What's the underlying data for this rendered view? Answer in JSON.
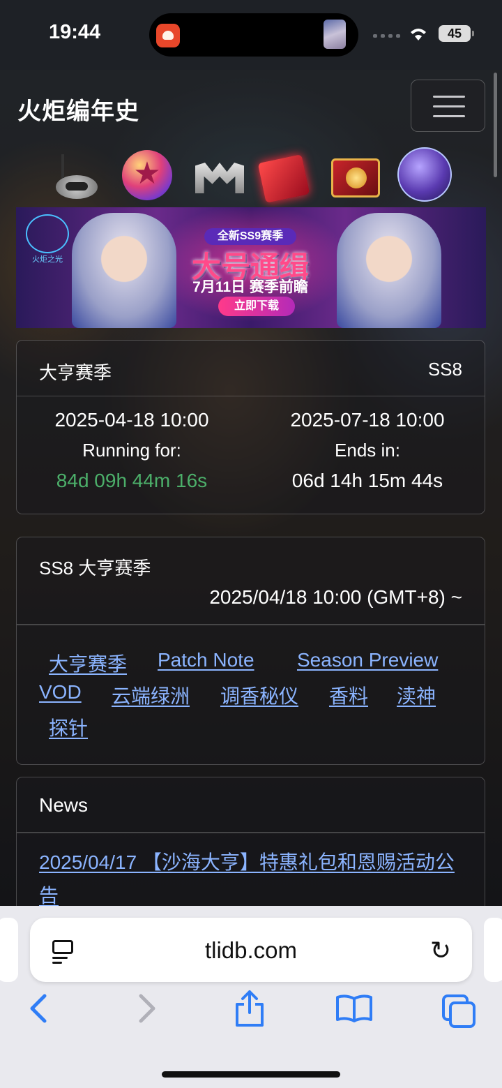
{
  "status_bar": {
    "time": "19:44",
    "battery": "45"
  },
  "header": {
    "site_title": "火炬编年史",
    "menu_icon": "hamburger-menu-icon"
  },
  "icon_row": [
    "mask-relic-icon",
    "star-orb-icon",
    "legendary-gear-icon",
    "red-cube-icon",
    "treasure-chest-icon",
    "void-crystal-icon"
  ],
  "banner": {
    "logo_text": "火炬之光",
    "tag": "全新SS9赛季",
    "headline": "大号通缉",
    "date": "7月11日 赛季前瞻",
    "cta": "立即下载"
  },
  "season_card": {
    "name": "大亨赛季",
    "code": "SS8",
    "start_datetime": "2025-04-18 10:00",
    "end_datetime": "2025-07-18 10:00",
    "running_label": "Running for:",
    "ends_label": "Ends in:",
    "running_value": "84d 09h 44m 16s",
    "ends_value": "06d 14h 15m 44s",
    "colors": {
      "running": "#4caf6a"
    }
  },
  "season_info": {
    "title": "SS8 大亨赛季",
    "start": "2025/04/18 10:00 (GMT+8) ~",
    "links": [
      "大亨赛季",
      "Patch Note",
      "Season Preview",
      "VOD",
      "云端绿洲",
      "调香秘仪",
      "香料",
      "渎神",
      "探针"
    ]
  },
  "news": {
    "title": "News",
    "items": [
      "2025/04/17 【沙海大亨】特惠礼包和恩赐活动公告"
    ]
  },
  "browser": {
    "url": "tlidb.com",
    "reader_icon": "reader-mode-icon",
    "reload_icon": "reload-icon",
    "toolbar": [
      "back-icon",
      "forward-icon",
      "share-icon",
      "bookmarks-icon",
      "tabs-icon"
    ],
    "accent_color": "#2f7df6"
  }
}
